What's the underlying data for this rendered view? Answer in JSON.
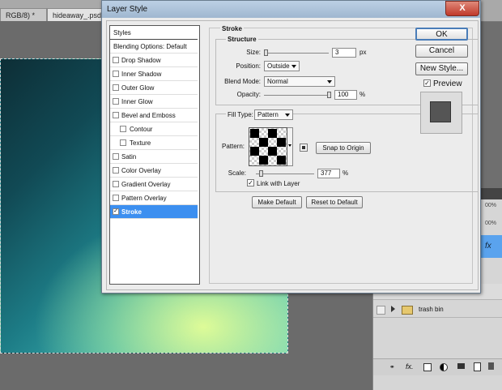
{
  "doc_tabs": [
    {
      "label": "RGB/8) *",
      "active": false
    },
    {
      "label": "hideaway_.psd",
      "active": true
    }
  ],
  "layers_panel": {
    "row_label": "trash bin",
    "percent_1": "00%",
    "percent_2": "00%",
    "fx_label": "fx"
  },
  "dialog": {
    "title": "Layer Style",
    "close_label": "X",
    "styles_header": "Styles",
    "style_items": [
      {
        "label": "Blending Options: Default",
        "checkbox": false,
        "checked": false,
        "indent": false,
        "selected": false
      },
      {
        "label": "Drop Shadow",
        "checkbox": true,
        "checked": false,
        "indent": false,
        "selected": false
      },
      {
        "label": "Inner Shadow",
        "checkbox": true,
        "checked": false,
        "indent": false,
        "selected": false
      },
      {
        "label": "Outer Glow",
        "checkbox": true,
        "checked": false,
        "indent": false,
        "selected": false
      },
      {
        "label": "Inner Glow",
        "checkbox": true,
        "checked": false,
        "indent": false,
        "selected": false
      },
      {
        "label": "Bevel and Emboss",
        "checkbox": true,
        "checked": false,
        "indent": false,
        "selected": false
      },
      {
        "label": "Contour",
        "checkbox": true,
        "checked": false,
        "indent": true,
        "selected": false
      },
      {
        "label": "Texture",
        "checkbox": true,
        "checked": false,
        "indent": true,
        "selected": false
      },
      {
        "label": "Satin",
        "checkbox": true,
        "checked": false,
        "indent": false,
        "selected": false
      },
      {
        "label": "Color Overlay",
        "checkbox": true,
        "checked": false,
        "indent": false,
        "selected": false
      },
      {
        "label": "Gradient Overlay",
        "checkbox": true,
        "checked": false,
        "indent": false,
        "selected": false
      },
      {
        "label": "Pattern Overlay",
        "checkbox": true,
        "checked": false,
        "indent": false,
        "selected": false
      },
      {
        "label": "Stroke",
        "checkbox": true,
        "checked": true,
        "indent": false,
        "selected": true
      }
    ],
    "stroke": {
      "section_title": "Stroke",
      "structure_title": "Structure",
      "size_label": "Size:",
      "size_value": "3",
      "size_unit": "px",
      "size_fraction": 0.02,
      "position_label": "Position:",
      "position_value": "Outside",
      "blend_mode_label": "Blend Mode:",
      "blend_mode_value": "Normal",
      "opacity_label": "Opacity:",
      "opacity_value": "100",
      "opacity_unit": "%",
      "opacity_fraction": 1.0,
      "fill_type_label": "Fill Type:",
      "fill_type_value": "Pattern",
      "pattern_label": "Pattern:",
      "snap_label": "Snap to Origin",
      "scale_label": "Scale:",
      "scale_value": "377",
      "scale_unit": "%",
      "scale_fraction": 0.08,
      "link_label": "Link with Layer",
      "link_checked": true,
      "make_default_label": "Make Default",
      "reset_default_label": "Reset to Default"
    },
    "buttons": {
      "ok": "OK",
      "cancel": "Cancel",
      "new_style": "New Style...",
      "preview": "Preview",
      "preview_checked": true
    }
  }
}
